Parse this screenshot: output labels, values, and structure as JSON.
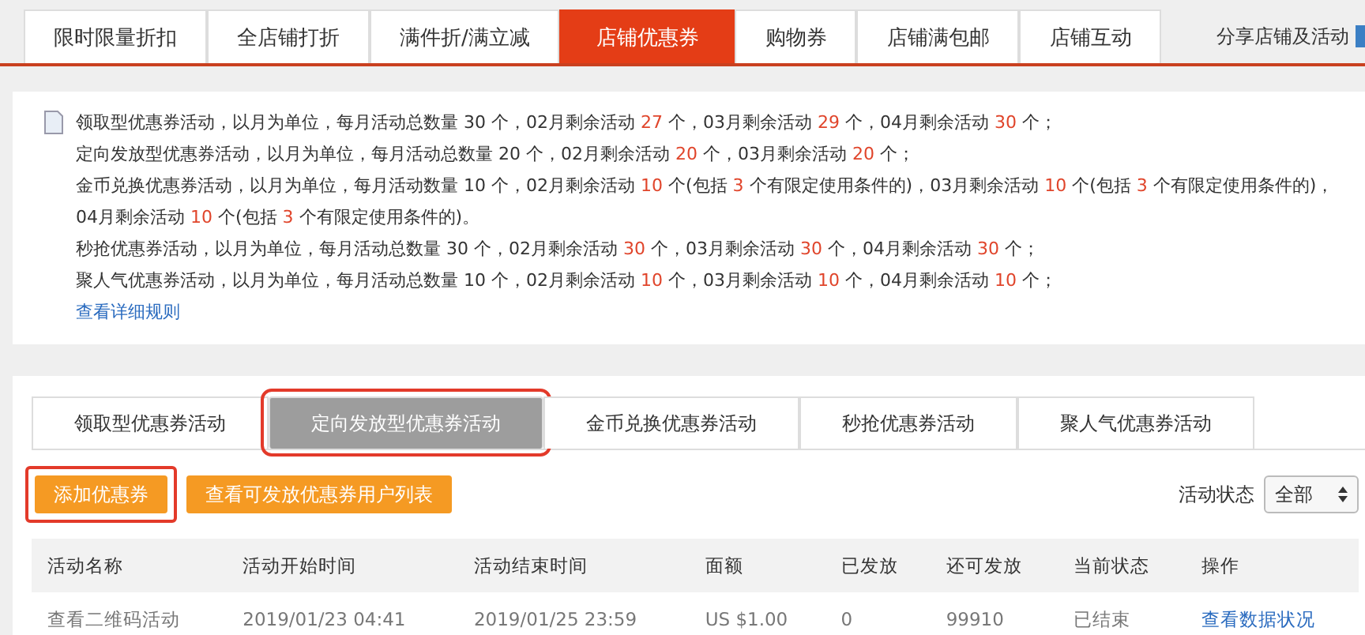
{
  "top_tabs": [
    {
      "label": "限时限量折扣",
      "selected": false
    },
    {
      "label": "全店铺打折",
      "selected": false
    },
    {
      "label": "满件折/满立减",
      "selected": false
    },
    {
      "label": "店铺优惠券",
      "selected": true
    },
    {
      "label": "购物券",
      "selected": false
    },
    {
      "label": "店铺满包邮",
      "selected": false
    },
    {
      "label": "店铺互动",
      "selected": false
    }
  ],
  "share_link": "分享店铺及活动",
  "notice": {
    "lines": [
      "领取型优惠券活动，以月为单位，每月活动总数量 30 个，02月剩余活动 **27** 个，03月剩余活动 **29** 个，04月剩余活动 **30** 个；",
      "定向发放型优惠券活动，以月为单位，每月活动总数量 20 个，02月剩余活动 **20** 个，03月剩余活动 **20** 个；",
      "金币兑换优惠券活动，以月为单位，每月活动数量 10 个，02月剩余活动 **10** 个(包括 **3** 个有限定使用条件的)，03月剩余活动 **10** 个(包括 **3** 个有限定使用条件的)，04月剩余活动 **10** 个(包括 **3** 个有限定使用条件的)。",
      "秒抢优惠券活动，以月为单位，每月活动总数量 30 个，02月剩余活动 **30** 个，03月剩余活动 **30** 个，04月剩余活动 **30** 个；",
      "聚人气优惠券活动，以月为单位，每月活动总数量 10 个，02月剩余活动 **10** 个，03月剩余活动 **10** 个，04月剩余活动 **10** 个；"
    ],
    "link": "查看详细规则"
  },
  "sub_tabs": [
    {
      "label": "领取型优惠券活动",
      "selected": false,
      "highlighted": false
    },
    {
      "label": "定向发放型优惠券活动",
      "selected": true,
      "highlighted": true
    },
    {
      "label": "金币兑换优惠券活动",
      "selected": false,
      "highlighted": false
    },
    {
      "label": "秒抢优惠券活动",
      "selected": false,
      "highlighted": false
    },
    {
      "label": "聚人气优惠券活动",
      "selected": false,
      "highlighted": false
    }
  ],
  "buttons": [
    {
      "label": "添加优惠券",
      "highlighted": true
    },
    {
      "label": "查看可发放优惠券用户列表",
      "highlighted": false
    }
  ],
  "status_filter": {
    "label": "活动状态",
    "value": "全部"
  },
  "table": {
    "columns": [
      "活动名称",
      "活动开始时间",
      "活动结束时间",
      "面额",
      "已发放",
      "还可发放",
      "当前状态",
      "操作"
    ],
    "rows": [
      {
        "cells": [
          "查看二维码活动",
          "2019/01/23 04:41",
          "2019/01/25 23:59",
          "US $1.00",
          "0",
          "99910",
          "已结束"
        ],
        "action": "查看数据状况"
      }
    ]
  }
}
